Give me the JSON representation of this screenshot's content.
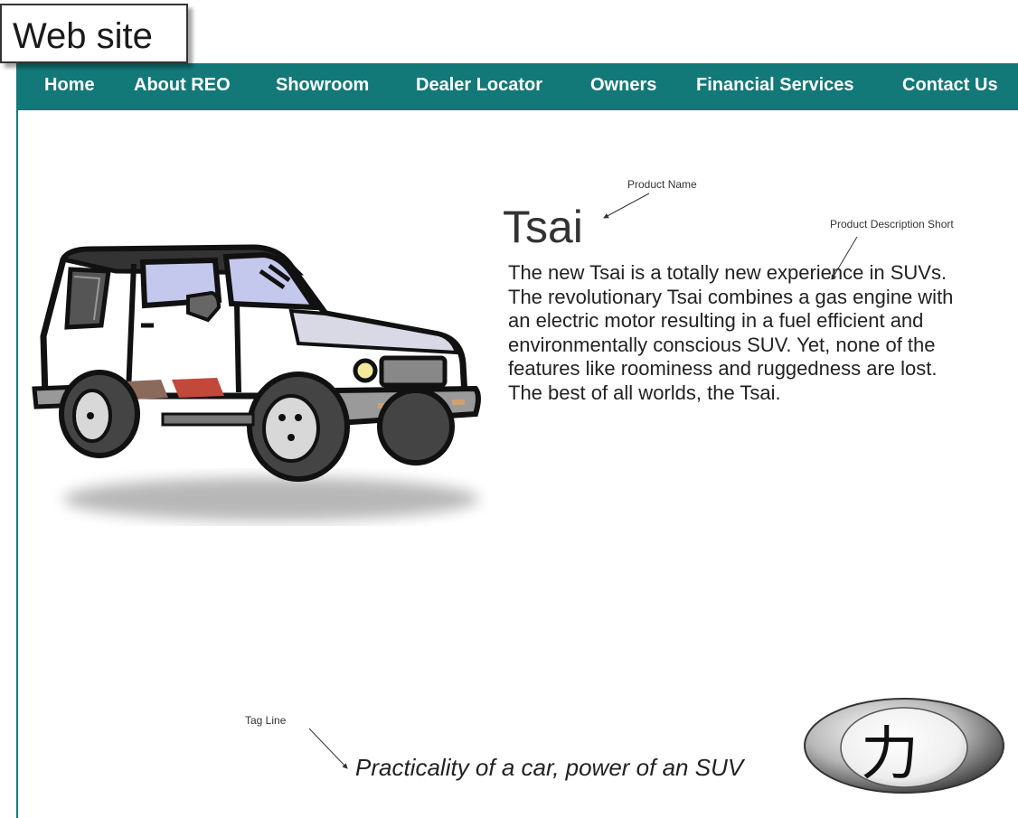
{
  "title_label": "Web site",
  "nav": {
    "items": [
      "Home",
      "About REO",
      "Showroom",
      "Dealer Locator",
      "Owners",
      "Financial Services",
      "Contact Us"
    ]
  },
  "product": {
    "name": "Tsai",
    "description": "The new Tsai is a totally new experience in SUVs. The revolutionary Tsai combines a gas engine with an electric motor resulting in a fuel efficient and environmentally conscious SUV. Yet, none of the features like roominess and ruggedness are lost. The best of all worlds, the Tsai.",
    "tagline": "Practicality of a car, power of an SUV"
  },
  "annotations": {
    "product_name": "Product Name",
    "product_description": "Product Description Short",
    "tag_line": "Tag Line"
  },
  "logo": {
    "glyph": "力"
  },
  "colors": {
    "nav_background": "#127878",
    "nav_text": "#ffffff"
  }
}
